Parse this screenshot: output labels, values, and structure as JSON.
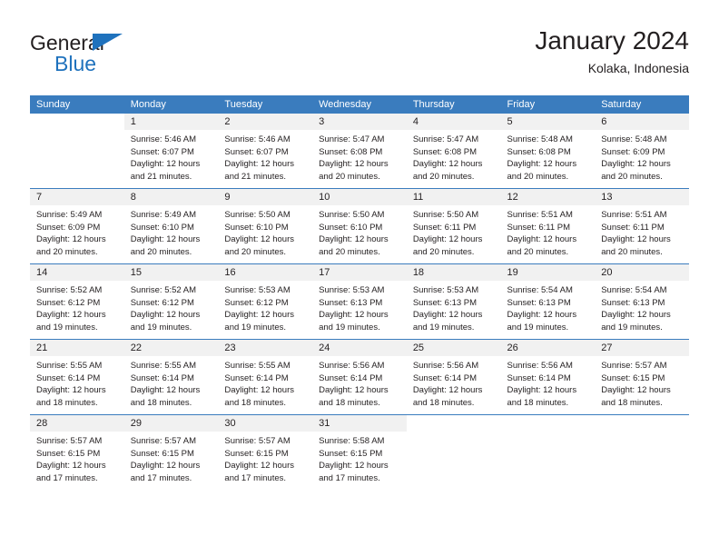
{
  "brand": {
    "name_part1": "General",
    "name_part2": "Blue",
    "triangle_icon": "blue-triangle-icon",
    "accent_color": "#1f72bd"
  },
  "header": {
    "title": "January 2024",
    "location": "Kolaka, Indonesia"
  },
  "theme": {
    "header_blue": "#3a7cbe",
    "daynum_band": "#f1f1f1",
    "text": "#231f20"
  },
  "calendar": {
    "weekday_headers": [
      "Sunday",
      "Monday",
      "Tuesday",
      "Wednesday",
      "Thursday",
      "Friday",
      "Saturday"
    ],
    "weeks": [
      [
        {
          "day": "",
          "blank": true,
          "sunrise": "",
          "sunset": "",
          "daylight_line1": "",
          "daylight_line2": ""
        },
        {
          "day": "1",
          "sunrise": "Sunrise: 5:46 AM",
          "sunset": "Sunset: 6:07 PM",
          "daylight_line1": "Daylight: 12 hours",
          "daylight_line2": "and 21 minutes."
        },
        {
          "day": "2",
          "sunrise": "Sunrise: 5:46 AM",
          "sunset": "Sunset: 6:07 PM",
          "daylight_line1": "Daylight: 12 hours",
          "daylight_line2": "and 21 minutes."
        },
        {
          "day": "3",
          "sunrise": "Sunrise: 5:47 AM",
          "sunset": "Sunset: 6:08 PM",
          "daylight_line1": "Daylight: 12 hours",
          "daylight_line2": "and 20 minutes."
        },
        {
          "day": "4",
          "sunrise": "Sunrise: 5:47 AM",
          "sunset": "Sunset: 6:08 PM",
          "daylight_line1": "Daylight: 12 hours",
          "daylight_line2": "and 20 minutes."
        },
        {
          "day": "5",
          "sunrise": "Sunrise: 5:48 AM",
          "sunset": "Sunset: 6:08 PM",
          "daylight_line1": "Daylight: 12 hours",
          "daylight_line2": "and 20 minutes."
        },
        {
          "day": "6",
          "sunrise": "Sunrise: 5:48 AM",
          "sunset": "Sunset: 6:09 PM",
          "daylight_line1": "Daylight: 12 hours",
          "daylight_line2": "and 20 minutes."
        }
      ],
      [
        {
          "day": "7",
          "sunrise": "Sunrise: 5:49 AM",
          "sunset": "Sunset: 6:09 PM",
          "daylight_line1": "Daylight: 12 hours",
          "daylight_line2": "and 20 minutes."
        },
        {
          "day": "8",
          "sunrise": "Sunrise: 5:49 AM",
          "sunset": "Sunset: 6:10 PM",
          "daylight_line1": "Daylight: 12 hours",
          "daylight_line2": "and 20 minutes."
        },
        {
          "day": "9",
          "sunrise": "Sunrise: 5:50 AM",
          "sunset": "Sunset: 6:10 PM",
          "daylight_line1": "Daylight: 12 hours",
          "daylight_line2": "and 20 minutes."
        },
        {
          "day": "10",
          "sunrise": "Sunrise: 5:50 AM",
          "sunset": "Sunset: 6:10 PM",
          "daylight_line1": "Daylight: 12 hours",
          "daylight_line2": "and 20 minutes."
        },
        {
          "day": "11",
          "sunrise": "Sunrise: 5:50 AM",
          "sunset": "Sunset: 6:11 PM",
          "daylight_line1": "Daylight: 12 hours",
          "daylight_line2": "and 20 minutes."
        },
        {
          "day": "12",
          "sunrise": "Sunrise: 5:51 AM",
          "sunset": "Sunset: 6:11 PM",
          "daylight_line1": "Daylight: 12 hours",
          "daylight_line2": "and 20 minutes."
        },
        {
          "day": "13",
          "sunrise": "Sunrise: 5:51 AM",
          "sunset": "Sunset: 6:11 PM",
          "daylight_line1": "Daylight: 12 hours",
          "daylight_line2": "and 20 minutes."
        }
      ],
      [
        {
          "day": "14",
          "sunrise": "Sunrise: 5:52 AM",
          "sunset": "Sunset: 6:12 PM",
          "daylight_line1": "Daylight: 12 hours",
          "daylight_line2": "and 19 minutes."
        },
        {
          "day": "15",
          "sunrise": "Sunrise: 5:52 AM",
          "sunset": "Sunset: 6:12 PM",
          "daylight_line1": "Daylight: 12 hours",
          "daylight_line2": "and 19 minutes."
        },
        {
          "day": "16",
          "sunrise": "Sunrise: 5:53 AM",
          "sunset": "Sunset: 6:12 PM",
          "daylight_line1": "Daylight: 12 hours",
          "daylight_line2": "and 19 minutes."
        },
        {
          "day": "17",
          "sunrise": "Sunrise: 5:53 AM",
          "sunset": "Sunset: 6:13 PM",
          "daylight_line1": "Daylight: 12 hours",
          "daylight_line2": "and 19 minutes."
        },
        {
          "day": "18",
          "sunrise": "Sunrise: 5:53 AM",
          "sunset": "Sunset: 6:13 PM",
          "daylight_line1": "Daylight: 12 hours",
          "daylight_line2": "and 19 minutes."
        },
        {
          "day": "19",
          "sunrise": "Sunrise: 5:54 AM",
          "sunset": "Sunset: 6:13 PM",
          "daylight_line1": "Daylight: 12 hours",
          "daylight_line2": "and 19 minutes."
        },
        {
          "day": "20",
          "sunrise": "Sunrise: 5:54 AM",
          "sunset": "Sunset: 6:13 PM",
          "daylight_line1": "Daylight: 12 hours",
          "daylight_line2": "and 19 minutes."
        }
      ],
      [
        {
          "day": "21",
          "sunrise": "Sunrise: 5:55 AM",
          "sunset": "Sunset: 6:14 PM",
          "daylight_line1": "Daylight: 12 hours",
          "daylight_line2": "and 18 minutes."
        },
        {
          "day": "22",
          "sunrise": "Sunrise: 5:55 AM",
          "sunset": "Sunset: 6:14 PM",
          "daylight_line1": "Daylight: 12 hours",
          "daylight_line2": "and 18 minutes."
        },
        {
          "day": "23",
          "sunrise": "Sunrise: 5:55 AM",
          "sunset": "Sunset: 6:14 PM",
          "daylight_line1": "Daylight: 12 hours",
          "daylight_line2": "and 18 minutes."
        },
        {
          "day": "24",
          "sunrise": "Sunrise: 5:56 AM",
          "sunset": "Sunset: 6:14 PM",
          "daylight_line1": "Daylight: 12 hours",
          "daylight_line2": "and 18 minutes."
        },
        {
          "day": "25",
          "sunrise": "Sunrise: 5:56 AM",
          "sunset": "Sunset: 6:14 PM",
          "daylight_line1": "Daylight: 12 hours",
          "daylight_line2": "and 18 minutes."
        },
        {
          "day": "26",
          "sunrise": "Sunrise: 5:56 AM",
          "sunset": "Sunset: 6:14 PM",
          "daylight_line1": "Daylight: 12 hours",
          "daylight_line2": "and 18 minutes."
        },
        {
          "day": "27",
          "sunrise": "Sunrise: 5:57 AM",
          "sunset": "Sunset: 6:15 PM",
          "daylight_line1": "Daylight: 12 hours",
          "daylight_line2": "and 18 minutes."
        }
      ],
      [
        {
          "day": "28",
          "sunrise": "Sunrise: 5:57 AM",
          "sunset": "Sunset: 6:15 PM",
          "daylight_line1": "Daylight: 12 hours",
          "daylight_line2": "and 17 minutes."
        },
        {
          "day": "29",
          "sunrise": "Sunrise: 5:57 AM",
          "sunset": "Sunset: 6:15 PM",
          "daylight_line1": "Daylight: 12 hours",
          "daylight_line2": "and 17 minutes."
        },
        {
          "day": "30",
          "sunrise": "Sunrise: 5:57 AM",
          "sunset": "Sunset: 6:15 PM",
          "daylight_line1": "Daylight: 12 hours",
          "daylight_line2": "and 17 minutes."
        },
        {
          "day": "31",
          "sunrise": "Sunrise: 5:58 AM",
          "sunset": "Sunset: 6:15 PM",
          "daylight_line1": "Daylight: 12 hours",
          "daylight_line2": "and 17 minutes."
        },
        {
          "day": "",
          "blank": true,
          "sunrise": "",
          "sunset": "",
          "daylight_line1": "",
          "daylight_line2": ""
        },
        {
          "day": "",
          "blank": true,
          "sunrise": "",
          "sunset": "",
          "daylight_line1": "",
          "daylight_line2": ""
        },
        {
          "day": "",
          "blank": true,
          "sunrise": "",
          "sunset": "",
          "daylight_line1": "",
          "daylight_line2": ""
        }
      ]
    ]
  }
}
